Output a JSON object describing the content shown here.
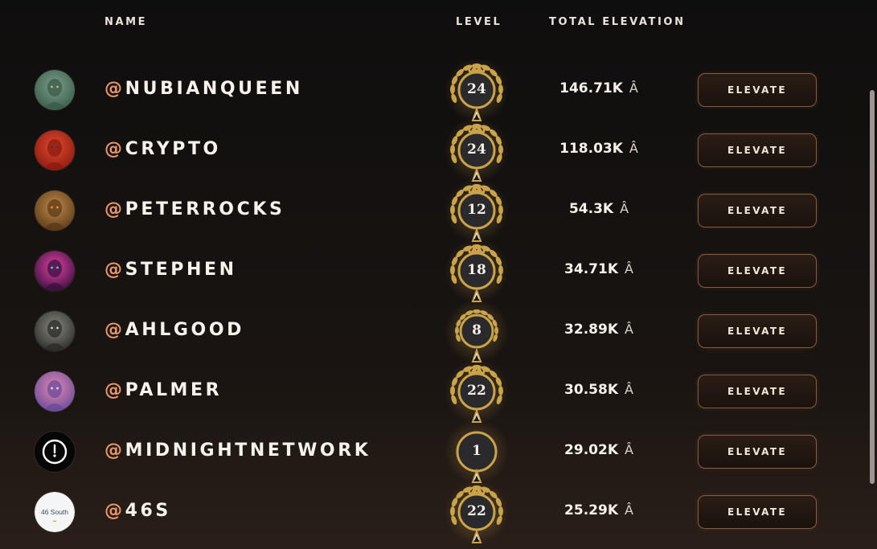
{
  "table": {
    "columns": {
      "name": "NAME",
      "level": "LEVEL",
      "total_elevation": "TOTAL ELEVATION"
    },
    "rows": [
      {
        "handle": "NUBIANQUEEN",
        "level": "24",
        "elevation": "146.71K",
        "unit": "Â",
        "button": "ELEVATE",
        "avatar": "warrior-queen-avatar",
        "badge": "laurel"
      },
      {
        "handle": "CRYPTO",
        "level": "24",
        "elevation": "118.03K",
        "unit": "Â",
        "button": "ELEVATE",
        "avatar": "red-hooded-figure-avatar",
        "badge": "laurel"
      },
      {
        "handle": "PETERROCKS",
        "level": "12",
        "elevation": "54.3K",
        "unit": "Â",
        "button": "ELEVATE",
        "avatar": "hooded-glowing-eyes-avatar",
        "badge": "laurel"
      },
      {
        "handle": "STEPHEN",
        "level": "18",
        "elevation": "34.71K",
        "unit": "Â",
        "button": "ELEVATE",
        "avatar": "neon-hooded-figure-avatar",
        "badge": "laurel"
      },
      {
        "handle": "AHLGOOD",
        "level": "8",
        "elevation": "32.89K",
        "unit": "Â",
        "button": "ELEVATE",
        "avatar": "bearded-sage-avatar",
        "badge": "small-laurel"
      },
      {
        "handle": "PALMER",
        "level": "22",
        "elevation": "30.58K",
        "unit": "Â",
        "button": "ELEVATE",
        "avatar": "pink-portrait-avatar",
        "badge": "laurel"
      },
      {
        "handle": "MIDNIGHTNETWORK",
        "level": "1",
        "elevation": "29.02K",
        "unit": "Â",
        "button": "ELEVATE",
        "avatar": "clock-logo-avatar",
        "badge": "plain"
      },
      {
        "handle": "46S",
        "level": "22",
        "elevation": "25.29K",
        "unit": "Â",
        "button": "ELEVATE",
        "avatar": "46-south-logo-avatar",
        "avatar_text": "46 South",
        "badge": "laurel"
      }
    ]
  },
  "handle_prefix": "@",
  "colors": {
    "accent": "#e8956a",
    "gold": "#c9a24a",
    "button_border": "#8a5a3c",
    "background": "#141110"
  }
}
